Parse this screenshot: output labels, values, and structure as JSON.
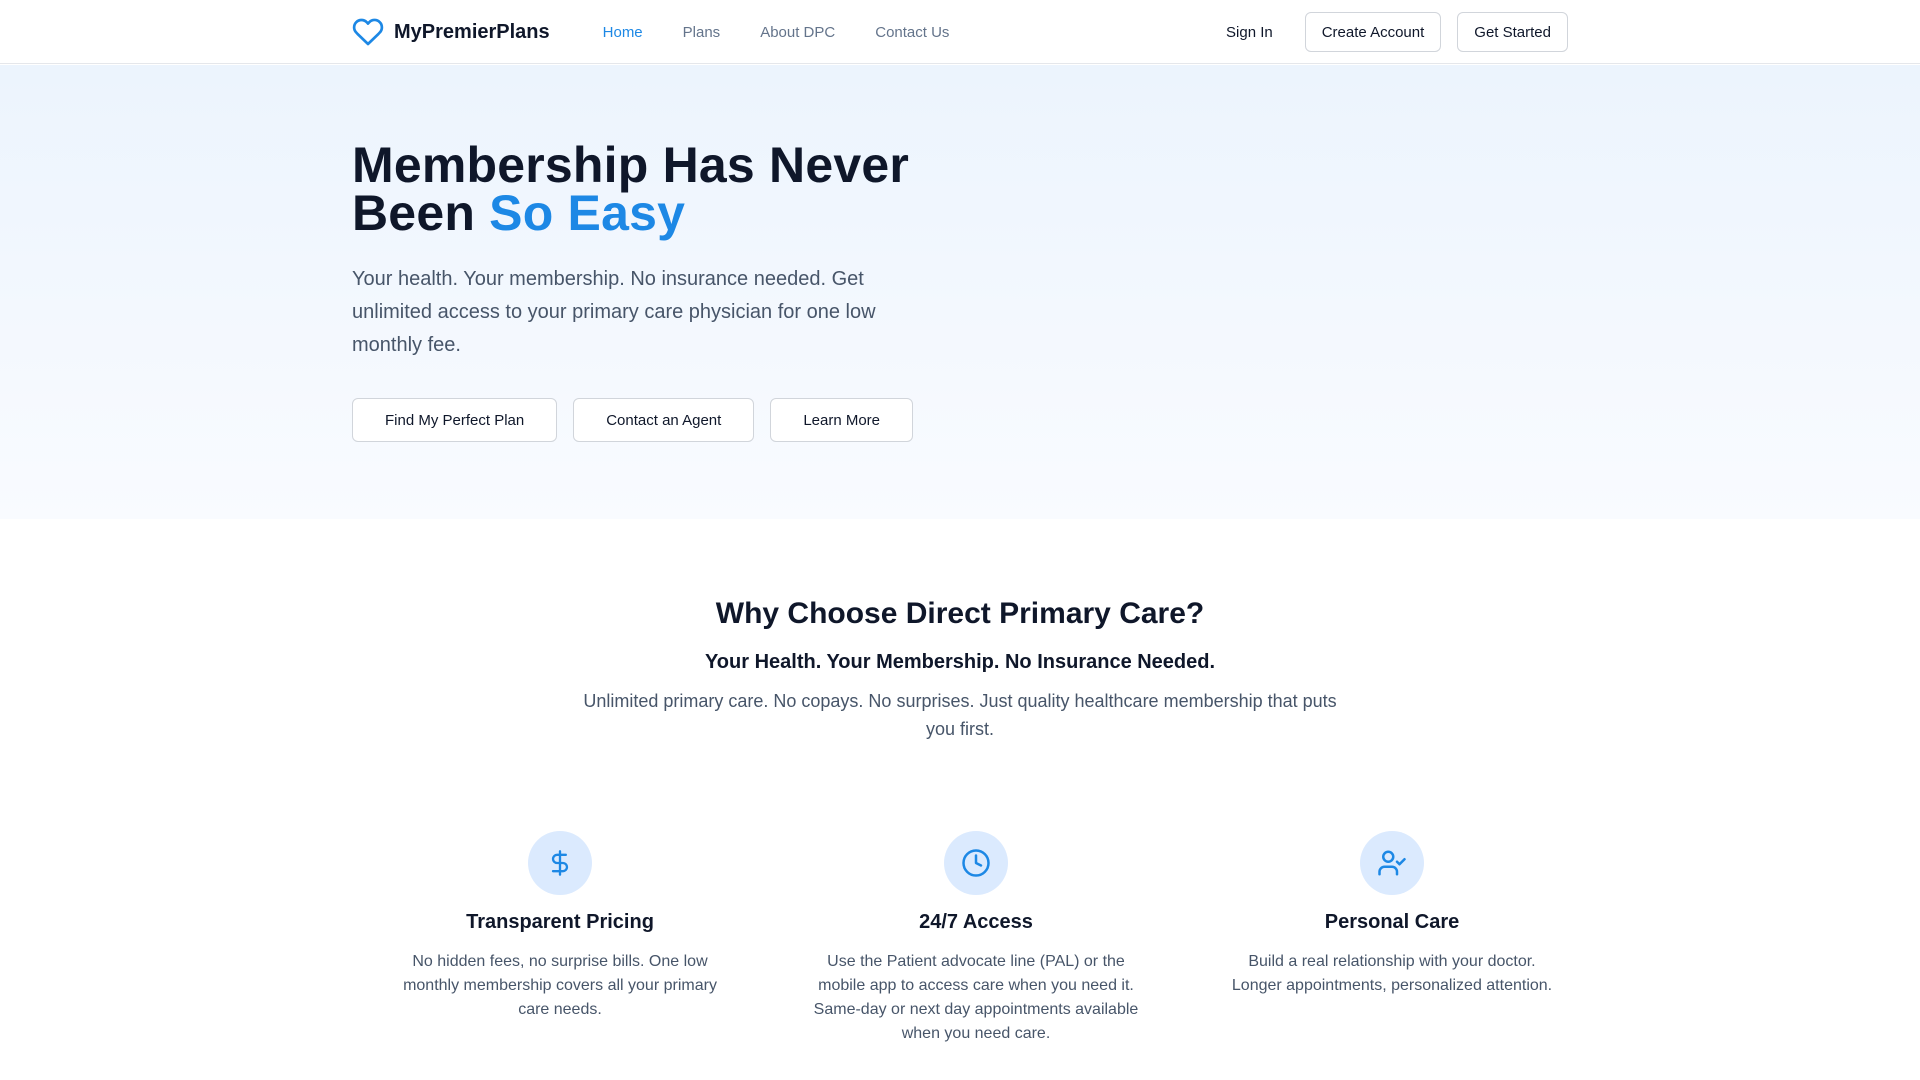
{
  "header": {
    "brand_name": "MyPremierPlans",
    "nav": [
      {
        "label": "Home",
        "active": true
      },
      {
        "label": "Plans",
        "active": false
      },
      {
        "label": "About DPC",
        "active": false
      },
      {
        "label": "Contact Us",
        "active": false
      }
    ],
    "sign_in": "Sign In",
    "create_account": "Create Account",
    "get_started": "Get Started"
  },
  "hero": {
    "title_line1": "Membership Has Never",
    "title_line2_prefix": "Been ",
    "title_accent": "So Easy",
    "subtitle": "Your health. Your membership. No insurance needed. Get unlimited access to your primary care physician for one low monthly fee.",
    "buttons": [
      "Find My Perfect Plan",
      "Contact an Agent",
      "Learn More"
    ]
  },
  "why": {
    "title": "Why Choose Direct Primary Care?",
    "subtitle": "Your Health. Your Membership. No Insurance Needed.",
    "description": "Unlimited primary care. No copays. No surprises. Just quality healthcare membership that puts you first.",
    "features": [
      {
        "icon": "dollar-icon",
        "title": "Transparent Pricing",
        "text": "No hidden fees, no surprise bills. One low monthly membership covers all your primary care needs."
      },
      {
        "icon": "clock-icon",
        "title": "24/7 Access",
        "text": "Use the Patient advocate line (PAL) or the mobile app to access care when you need it. Same-day or next day appointments available when you need care."
      },
      {
        "icon": "user-check-icon",
        "title": "Personal Care",
        "text": "Build a real relationship with your doctor. Longer appointments, personalized attention."
      }
    ]
  },
  "colors": {
    "accent": "#1d88e5",
    "text_dark": "#0f172a",
    "text_muted": "#475569",
    "icon_bg": "#dbeafe"
  }
}
